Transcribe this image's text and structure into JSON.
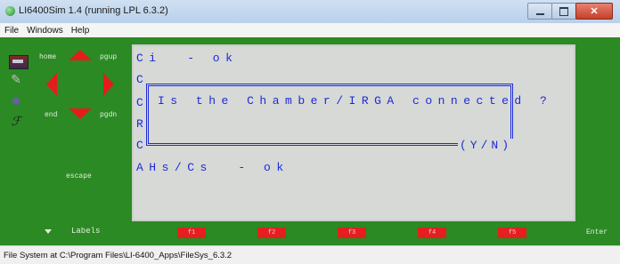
{
  "window": {
    "title": "LI6400Sim 1.4 (running LPL 6.3.2)"
  },
  "menu": [
    "File",
    "Windows",
    "Help"
  ],
  "nav": {
    "home": "home",
    "pgup": "pgup",
    "end": "end",
    "pgdn": "pgdn",
    "escape": "escape"
  },
  "tools": [
    "keyboard-icon",
    "wand-icon",
    "person-icon",
    "signature-icon"
  ],
  "screen": {
    "line1": "Ci  - ok",
    "line2": "C",
    "line3": "C",
    "line4": "R",
    "line5": "C",
    "line6": "AHs/Cs  - ok",
    "dialog_text": "Is the Chamber/IRGA connected ?",
    "dialog_choice": "(Y/N)"
  },
  "function_keys": [
    "f1",
    "f2",
    "f3",
    "f4",
    "f5"
  ],
  "labels_button": "Labels",
  "enter_label": "Enter",
  "status": "File System at C:\\Program Files\\LI-6400_Apps\\FileSys_6.3.2",
  "colors": {
    "panel": "#2b8a23",
    "accent": "#e31d1d",
    "screen_text": "#1c2bd8",
    "screen_bg": "#d6d9d6"
  }
}
